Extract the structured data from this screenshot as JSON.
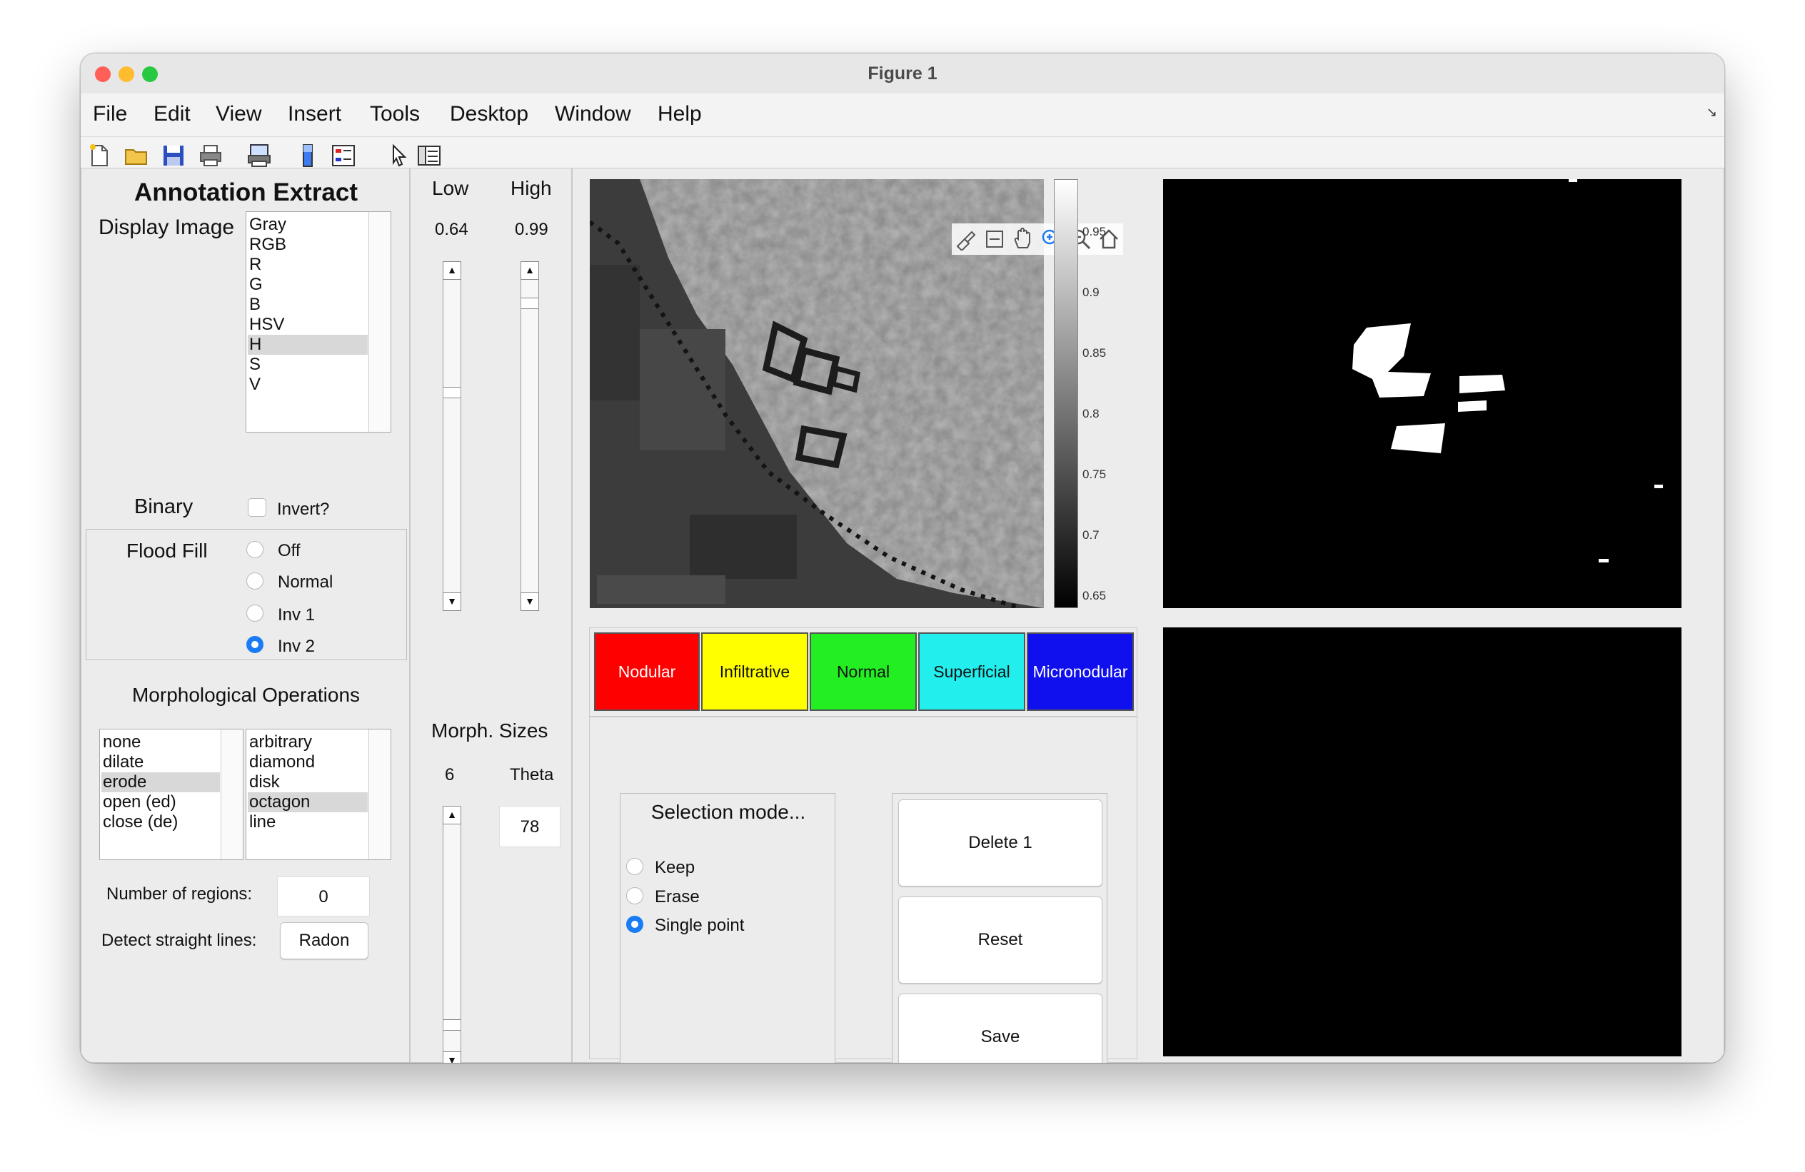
{
  "window": {
    "title": "Figure 1"
  },
  "menu": [
    "File",
    "Edit",
    "View",
    "Insert",
    "Tools",
    "Desktop",
    "Window",
    "Help"
  ],
  "toolbar_icons": [
    "new-file-icon",
    "open-folder-icon",
    "save-icon",
    "print-icon",
    "print-figure-icon",
    "colorbar-icon",
    "legend-icon",
    "pointer-icon",
    "property-inspector-icon"
  ],
  "left_panel": {
    "title": "Annotation Extract",
    "display_image_label": "Display Image",
    "display_image_options": [
      "Gray",
      "RGB",
      "R",
      "G",
      "B",
      "HSV",
      "H",
      "S",
      "V"
    ],
    "display_image_selected": "H",
    "binary_label": "Binary",
    "invert_label": "Invert?",
    "invert_checked": false,
    "flood_fill_label": "Flood Fill",
    "flood_fill_options": [
      "Off",
      "Normal",
      "Inv 1",
      "Inv 2"
    ],
    "flood_fill_selected": "Inv 2",
    "morph_label": "Morphological Operations",
    "morph_ops": [
      "none",
      "dilate",
      "erode",
      "open (ed)",
      "close (de)"
    ],
    "morph_op_selected": "erode",
    "morph_shapes": [
      "arbitrary",
      "diamond",
      "disk",
      "octagon",
      "line"
    ],
    "morph_shape_selected": "octagon",
    "regions_label": "Number of regions:",
    "regions_value": "0",
    "lines_label": "Detect straight lines:",
    "radon_label": "Radon"
  },
  "threshold_panel": {
    "low_label": "Low",
    "high_label": "High",
    "low_value": "0.64",
    "high_value": "0.99",
    "morph_sizes_label": "Morph. Sizes",
    "size_value": "6",
    "theta_label": "Theta",
    "theta_value": "78"
  },
  "colorbar": {
    "ticks": [
      "0.95",
      "0.9",
      "0.85",
      "0.8",
      "0.75",
      "0.7",
      "0.65"
    ]
  },
  "classes": [
    {
      "label": "Nodular",
      "color": "#ff0000",
      "text": "#ffffff"
    },
    {
      "label": "Infiltrative",
      "color": "#ffff00",
      "text": "#111111"
    },
    {
      "label": "Normal",
      "color": "#22ee22",
      "text": "#111111"
    },
    {
      "label": "Superficial",
      "color": "#22eeee",
      "text": "#111111"
    },
    {
      "label": "Micronodular",
      "color": "#1010ee",
      "text": "#ffffff"
    }
  ],
  "selection": {
    "title": "Selection mode...",
    "options": [
      "Keep",
      "Erase",
      "Single point"
    ],
    "selected": "Single point"
  },
  "actions": {
    "delete": "Delete 1",
    "reset": "Reset",
    "save": "Save"
  }
}
